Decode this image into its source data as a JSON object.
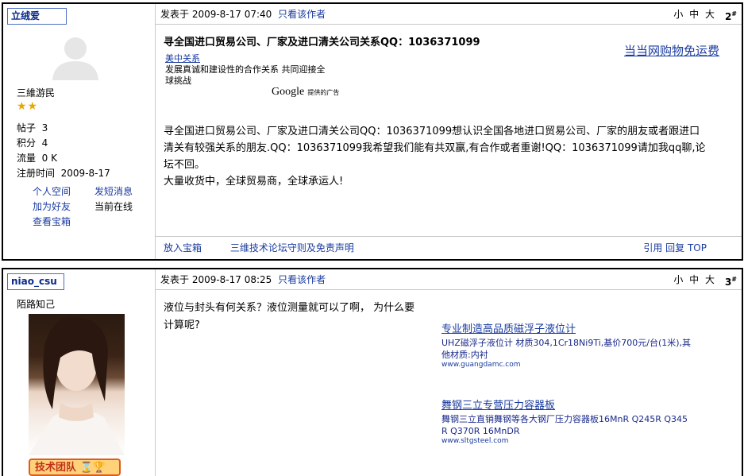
{
  "post1": {
    "username": "立绒爱",
    "user_title": "三維游民",
    "stats": [
      {
        "label": "帖子",
        "value": "3"
      },
      {
        "label": "积分",
        "value": "4"
      },
      {
        "label": "流量",
        "value": "0 K"
      },
      {
        "label": "注册时间",
        "value": "2009-8-17"
      }
    ],
    "links": [
      "个人空间",
      "发短消息",
      "加为好友",
      "当前在线",
      "查看宝箱"
    ],
    "posted_prefix": "发表于 2009-8-17 07:40",
    "only_author": "只看该作者",
    "font_sizes": "小 中 大",
    "floor": "2",
    "floor_suffix": "#",
    "title": "寻全国进口贸易公司、厂家及进口清关公司关系QQ：1036371099",
    "ad_link_right": "当当网购物免运费",
    "ad": {
      "link": "美中关系",
      "desc_line1": "发展真诚和建设性的合作关系 共同迎接全",
      "desc_line2": "球挑战",
      "google_label": "Google",
      "google_suffix": "提供的广告"
    },
    "body_line1": "寻全国进口贸易公司、厂家及进口清关公司QQ：1036371099想认识全国各地进口贸易公司、厂家的朋友或者跟进口",
    "body_line2": "清关有较强关系的朋友.QQ：1036371099我希望我们能有共双赢,有合作或者重谢!QQ：1036371099请加我qq聊,论",
    "body_line3": "坛不回。",
    "body_line4": "大量收货中，全球贸易商，全球承运人!",
    "footer_left1": "放入宝箱",
    "footer_left2": "三维技术论坛守则及免责声明",
    "footer_right": "引用 回复 TOP"
  },
  "post2": {
    "username": "niao_csu",
    "user_title": "陌路知己",
    "badge": "技术团队",
    "posted_prefix": "发表于 2009-8-17 08:25",
    "only_author": "只看该作者",
    "font_sizes": "小 中 大",
    "floor": "3",
    "floor_suffix": "#",
    "body_line1": "液位与封头有何关系？液位测量就可以了啊， 为什么要",
    "body_line2": "计算呢?",
    "ads": [
      {
        "title": "专业制造高品质磁浮子液位计",
        "desc_line1": "UHZ磁浮子液位计 材质304,1Cr18Ni9Ti,基价700元/台(1米),其",
        "desc_line2": "他材质:内衬",
        "url": "www.guangdamc.com"
      },
      {
        "title": "舞钢三立专营压力容器板",
        "desc_line1": "舞钢三立直销舞钢等各大钢厂压力容器板16MnR Q245R Q345",
        "desc_line2": "R Q370R 16MnDR",
        "url": "www.sltgsteel.com"
      }
    ]
  }
}
